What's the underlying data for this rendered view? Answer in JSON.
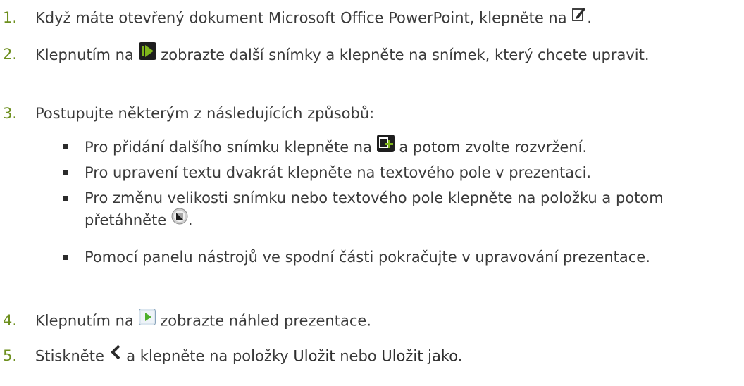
{
  "steps": [
    {
      "num": "1.",
      "a": "Když máte otevřený dokument Microsoft Office PowerPoint, klepněte na",
      "b": "."
    },
    {
      "num": "2.",
      "a": "Klepnutím na",
      "b": "zobrazte další snímky a klepněte na snímek, který chcete upravit."
    },
    {
      "num": "3.",
      "a": "Postupujte některým z následujících způsobů:"
    },
    {
      "num": "4.",
      "a": "Klepnutím na",
      "b": "zobrazte náhled prezentace."
    },
    {
      "num": "5.",
      "a": "Stiskněte",
      "b": "a klepněte na položky",
      "c": "Uložit",
      "d": "nebo",
      "e": "Uložit jako",
      "f": "."
    }
  ],
  "bullets": [
    {
      "a": "Pro přidání dalšího snímku klepněte na",
      "b": "a potom zvolte rozvržení."
    },
    {
      "a": "Pro upravení textu dvakrát klepněte na textového pole v prezentaci."
    },
    {
      "a": "Pro změnu velikosti snímku nebo textového pole klepněte na položku a potom přetáhněte",
      "b": "."
    },
    {
      "a": "Pomocí panelu nástrojů ve spodní části pokračujte v upravování prezentace."
    }
  ],
  "icons": {
    "edit": "edit-pencil-icon",
    "next": "next-slides-icon",
    "add": "add-slide-icon",
    "resize": "resize-handle-icon",
    "preview": "preview-play-icon",
    "back": "back-chevron-icon"
  },
  "colors": {
    "number": "#6d8f1e",
    "text": "#3a3a3a"
  }
}
